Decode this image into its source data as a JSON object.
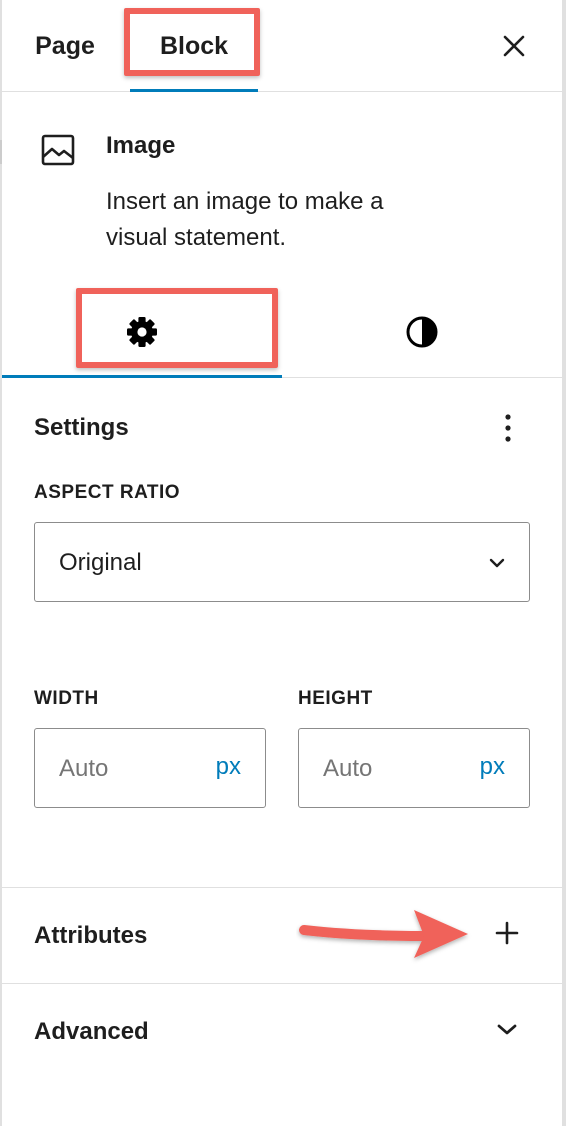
{
  "header": {
    "tabs": [
      {
        "label": "Page",
        "active": false
      },
      {
        "label": "Block",
        "active": true
      }
    ],
    "close_icon": "close-icon"
  },
  "block_card": {
    "icon": "image-icon",
    "title": "Image",
    "description": "Insert an image to make a visual statement."
  },
  "inspector_tabs": [
    {
      "icon": "gear-icon",
      "active": true
    },
    {
      "icon": "contrast-icon",
      "active": false
    }
  ],
  "settings": {
    "title": "Settings",
    "options_icon": "more-vertical-icon",
    "aspect_ratio": {
      "label": "ASPECT RATIO",
      "value": "Original"
    },
    "width": {
      "label": "WIDTH",
      "placeholder": "Auto",
      "unit": "px"
    },
    "height": {
      "label": "HEIGHT",
      "placeholder": "Auto",
      "unit": "px"
    }
  },
  "panels": {
    "attributes": {
      "title": "Attributes",
      "icon": "plus-icon"
    },
    "advanced": {
      "title": "Advanced",
      "icon": "chevron-down-icon"
    }
  },
  "colors": {
    "accent": "#007cba",
    "highlight": "#f0625a",
    "text": "#1e1e1e",
    "border": "#e0e0e0"
  }
}
